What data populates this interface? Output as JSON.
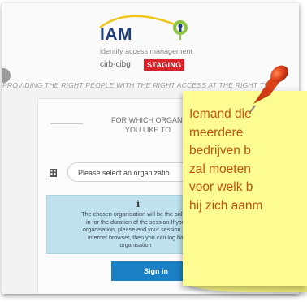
{
  "logo": {
    "name": "IAM",
    "subtitle": "identity access management",
    "brand": "cirb-cibg",
    "badge": "STAGING"
  },
  "tagline": "PROVIDING THE RIGHT PEOPLE WITH THE RIGHT ACCESS AT THE RIGHT TIME",
  "card": {
    "question_line1": "FOR WHICH ORGANI",
    "question_line2": "YOU LIKE TO",
    "select_placeholder": "Please select an organizatio",
    "info_icon": "i",
    "info_lines": [
      "The chosen organisation will be the only c",
      "in for the duration of the session.If you",
      "organisation, please end your session by",
      "internet browser, then you can log ba",
      "organisation"
    ],
    "signin_label": "Sign in"
  },
  "note": {
    "lines": [
      "Iemand die",
      "meerdere",
      "bedrijven b",
      "zal moeten",
      "voor welk b",
      "hij zich aanm"
    ]
  },
  "colors": {
    "accent": "#1a7fc3",
    "staging": "#d6232a",
    "note_bg": "#fdfc93",
    "note_text": "#c0540f",
    "info_bg": "#bfe2ee"
  },
  "icons": {
    "logo_pin": "key-pin-icon",
    "building": "building-icon",
    "pushpin": "pushpin-icon"
  }
}
